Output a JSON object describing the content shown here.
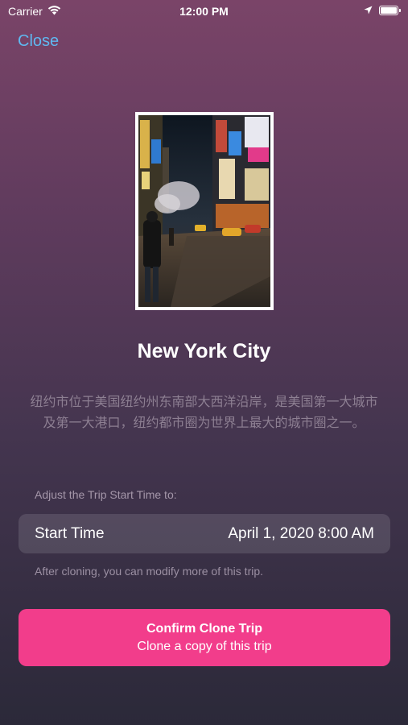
{
  "status_bar": {
    "carrier": "Carrier",
    "time": "12:00 PM",
    "battery_level": 1.0
  },
  "nav": {
    "close_label": "Close"
  },
  "trip": {
    "photo_icon": "city-street-photo",
    "city_name": "New York City",
    "description": "纽约市位于美国纽约州东南部大西洋沿岸，是美国第一大城市及第一大港口，纽约都市圈为世界上最大的城市圈之一。"
  },
  "start_time": {
    "adjust_label": "Adjust the Trip Start Time to:",
    "label": "Start Time",
    "value": "April 1, 2020 8:00 AM",
    "note": "After cloning, you can modify more of this trip."
  },
  "confirm_button": {
    "title": "Confirm Clone Trip",
    "subtitle": "Clone a copy of this trip",
    "color": "#f23d8b"
  },
  "colors": {
    "link": "#5fb8f0",
    "background_top": "#7a4468",
    "background_bottom": "#2b2939"
  }
}
